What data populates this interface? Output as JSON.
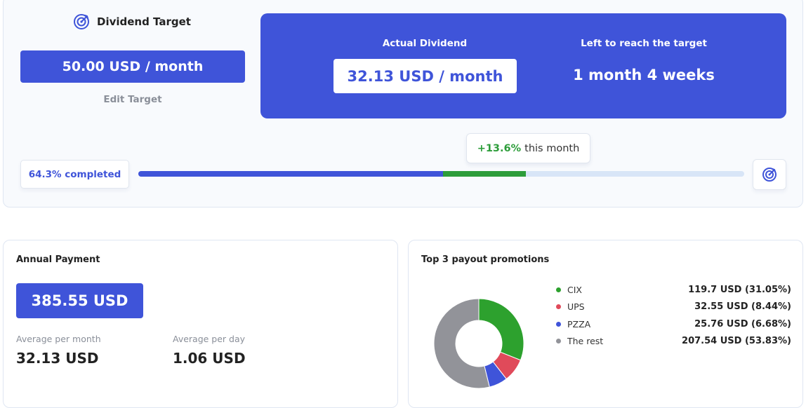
{
  "target": {
    "title": "Dividend Target",
    "value": "50.00 USD / month",
    "edit_label": "Edit Target"
  },
  "summary": {
    "actual_label": "Actual Dividend",
    "actual_value": "32.13 USD / month",
    "left_label": "Left to reach the target",
    "left_value": "1 month 4 weeks"
  },
  "progress": {
    "completed_label": "64.3% completed",
    "completed_fraction": 0.503,
    "gain_fraction": 0.137,
    "gain_pct": "+13.6%",
    "gain_suffix": "this month"
  },
  "annual": {
    "title": "Annual Payment",
    "value": "385.55 USD",
    "avg_month_label": "Average per month",
    "avg_month_value": "32.13 USD",
    "avg_day_label": "Average per day",
    "avg_day_value": "1.06 USD"
  },
  "payout": {
    "title": "Top 3 payout promotions",
    "items": [
      {
        "name": "CIX",
        "value": "119.7 USD (31.05%)",
        "share": 31.05,
        "color": "#2da12e"
      },
      {
        "name": "UPS",
        "value": "32.55 USD (8.44%)",
        "share": 8.44,
        "color": "#e04a5a"
      },
      {
        "name": "PZZA",
        "value": "25.76 USD (6.68%)",
        "share": 6.68,
        "color": "#3f54d9"
      },
      {
        "name": "The rest",
        "value": "207.54 USD (53.83%)",
        "share": 53.83,
        "color": "#929399"
      }
    ]
  },
  "icons": {
    "target": "target-icon",
    "target_end": "target-icon"
  },
  "colors": {
    "accent": "#3f54d9",
    "positive": "#2d9d3a",
    "track": "#d8e5f7"
  }
}
